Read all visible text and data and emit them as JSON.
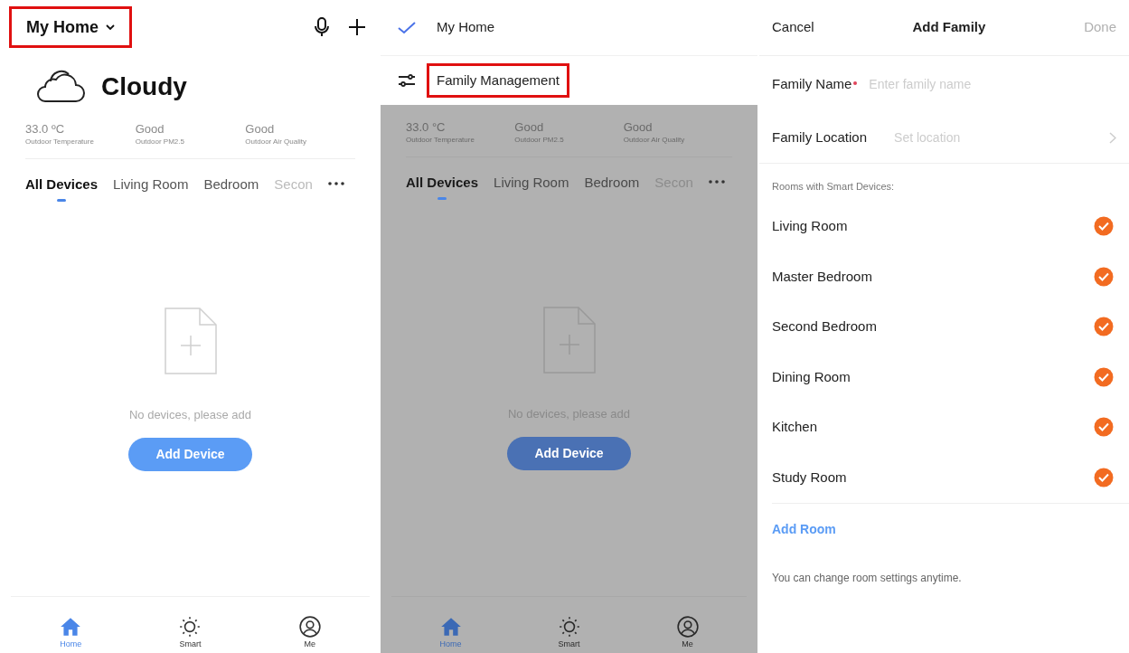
{
  "home_screen": {
    "home_selector": {
      "label": "My Home",
      "highlighted": true
    },
    "weather": {
      "condition": "Cloudy"
    },
    "stats": [
      {
        "value": "33.0 ºC",
        "label": "Outdoor Temperature"
      },
      {
        "value": "Good",
        "label": "Outdoor PM2.5"
      },
      {
        "value": "Good",
        "label": "Outdoor Air Quality"
      }
    ],
    "tabs": [
      {
        "label": "All Devices",
        "selected": true
      },
      {
        "label": "Living Room",
        "selected": false
      },
      {
        "label": "Bedroom",
        "selected": false
      },
      {
        "label": "Secon",
        "selected": false
      }
    ],
    "empty_state": {
      "message": "No devices, please add",
      "button": "Add Device"
    },
    "nav": [
      {
        "label": "Home",
        "kind": "home",
        "selected": true
      },
      {
        "label": "Smart",
        "kind": "smart",
        "selected": false
      },
      {
        "label": "Me",
        "kind": "me",
        "selected": false
      }
    ]
  },
  "menu_screen": {
    "menu": [
      {
        "label": "My Home",
        "kind": "home",
        "checked": true,
        "highlighted": false
      },
      {
        "label": "Family Management",
        "kind": "manage",
        "highlighted": true
      }
    ],
    "stats": [
      {
        "value": "33.0 °C",
        "label": "Outdoor Temperature"
      },
      {
        "value": "Good",
        "label": "Outdoor PM2.5"
      },
      {
        "value": "Good",
        "label": "Outdoor Air Quality"
      }
    ],
    "tabs": [
      {
        "label": "All Devices",
        "selected": true
      },
      {
        "label": "Living Room",
        "selected": false
      },
      {
        "label": "Bedroom",
        "selected": false
      },
      {
        "label": "Secon",
        "selected": false
      }
    ],
    "empty_state": {
      "message": "No devices, please add",
      "button": "Add Device"
    },
    "nav": [
      {
        "label": "Home",
        "kind": "home",
        "selected": true
      },
      {
        "label": "Smart",
        "kind": "smart",
        "selected": false
      },
      {
        "label": "Me",
        "kind": "me",
        "selected": false
      }
    ]
  },
  "add_family": {
    "cancel": "Cancel",
    "title": "Add Family",
    "done": {
      "label": "Done",
      "disabled": true
    },
    "fields": [
      {
        "label": "Family Name",
        "kind": "text",
        "required": true,
        "placeholder": "Enter family name"
      },
      {
        "label": "Family Location",
        "kind": "picker",
        "placeholder": "Set location"
      }
    ],
    "rooms_header": "Rooms with Smart Devices:",
    "rooms": [
      {
        "name": "Living Room",
        "checked": true
      },
      {
        "name": "Master Bedroom",
        "checked": true
      },
      {
        "name": "Second Bedroom",
        "checked": true
      },
      {
        "name": "Dining Room",
        "checked": true
      },
      {
        "name": "Kitchen",
        "checked": true
      },
      {
        "name": "Study Room",
        "checked": true
      }
    ],
    "add_room": "Add Room",
    "note": "You can change room settings anytime."
  }
}
